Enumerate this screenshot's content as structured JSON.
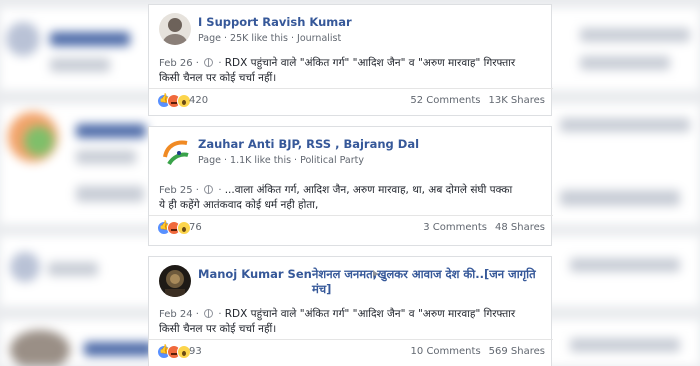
{
  "posts": [
    {
      "page_name": "I Support Ravish Kumar",
      "page_type": "Page",
      "likes": "25K like this",
      "category": "Journalist",
      "date": "Feb 26",
      "text_line1": "RDX पहुंचाने वाले \"अंकित गर्ग\" \"आदिश जैन\" व \"अरुण मारवाह\" गिरफ्तार",
      "text_line2": "किसी चैनल पर कोई चर्चा नहीं।",
      "reactions": "420",
      "comments": "52 Comments",
      "shares": "13K Shares"
    },
    {
      "page_name": "Zauhar Anti BJP, RSS , Bajrang Dal",
      "page_type": "Page",
      "likes": "1.1K like this",
      "category": "Political Party",
      "date": "Feb 25",
      "text_line1": "...वाला अंकित गर्ग, आदिश जैन, अरुण मारवाह, था, अब दोगले संघी पक्का",
      "text_line2": "ये ही कहेंगे आतंकवाद कोई धर्म नही होता,",
      "reactions": "76",
      "comments": "3 Comments",
      "shares": "48 Shares"
    },
    {
      "page_name": "Manoj Kumar Sen",
      "shared_to": "नेशनल जनमत,खुलकर आवाज देश की..[जन जागृति मंच]",
      "date": "Feb 24",
      "text_line1": "RDX पहुंचाने वाले \"अंकित गर्ग\" \"आदिश जैन\" व \"अरुण मारवाह\" गिरफ्तार",
      "text_line2": "किसी चैनल पर कोई चर्चा नहीं।",
      "reactions": "93",
      "comments": "10 Comments",
      "shares": "569 Shares"
    }
  ],
  "colors": {
    "link_blue": "#365899",
    "meta_grey": "#616770",
    "like_blue": "#5890ff",
    "background": "#e9ebee"
  }
}
